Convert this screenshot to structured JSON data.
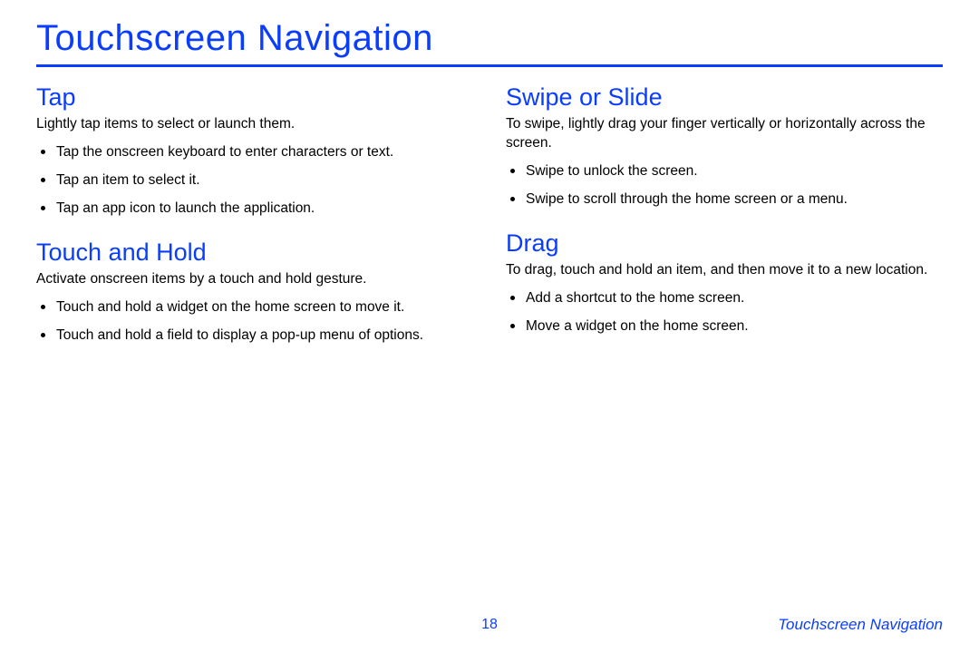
{
  "title": "Touchscreen Navigation",
  "left": {
    "section1": {
      "heading": "Tap",
      "intro": "Lightly tap items to select or launch them.",
      "items": [
        "Tap the onscreen keyboard to enter characters or text.",
        "Tap an item to select it.",
        "Tap an app icon to launch the application."
      ]
    },
    "section2": {
      "heading": "Touch and Hold",
      "intro": "Activate onscreen items by a touch and hold gesture.",
      "items": [
        "Touch and hold a widget on the home screen to move it.",
        "Touch and hold a field to display a pop-up menu of options."
      ]
    }
  },
  "right": {
    "section1": {
      "heading": "Swipe or Slide",
      "intro": "To swipe, lightly drag your finger vertically or horizontally across the screen.",
      "items": [
        "Swipe to unlock the screen.",
        "Swipe to scroll through the home screen or a menu."
      ]
    },
    "section2": {
      "heading": "Drag",
      "intro": "To drag, touch and hold an item, and then move it to a new location.",
      "items": [
        "Add a shortcut to the home screen.",
        "Move a widget on the home screen."
      ]
    }
  },
  "footer": {
    "page": "18",
    "label": "Touchscreen Navigation"
  }
}
